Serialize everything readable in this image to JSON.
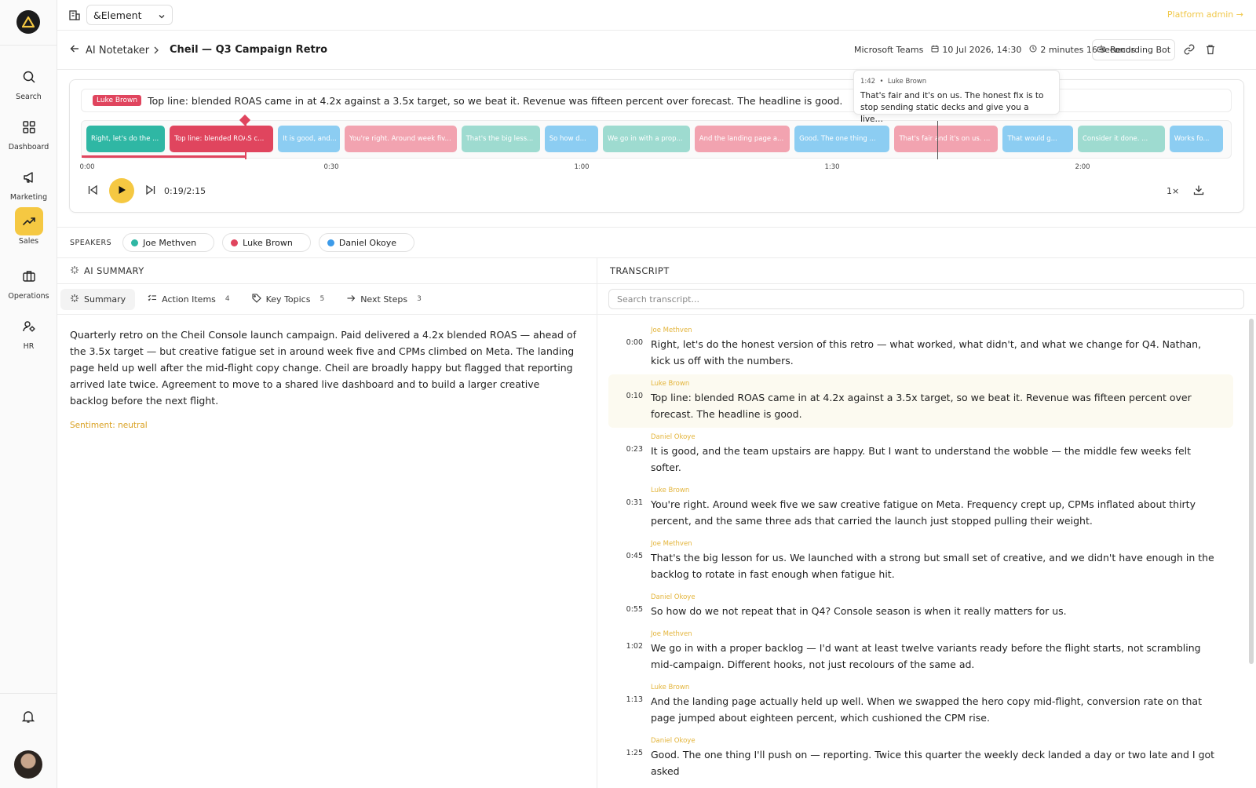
{
  "sidebar": {
    "items": [
      {
        "label": "Search",
        "icon": "search-icon"
      },
      {
        "label": "Dashboard",
        "icon": "dashboard-icon"
      },
      {
        "label": "Marketing",
        "icon": "megaphone-icon"
      },
      {
        "label": "Sales",
        "icon": "trending-up-icon",
        "active": true
      },
      {
        "label": "Operations",
        "icon": "briefcase-icon"
      },
      {
        "label": "HR",
        "icon": "people-icon"
      }
    ]
  },
  "topbar": {
    "org": "&Element",
    "platform_admin": "Platform admin →"
  },
  "header": {
    "back_label": "AI Notetaker",
    "title": "Cheil — Q3 Campaign Retro",
    "platform": "Microsoft Teams",
    "date": "10 Jul 2026, 14:30",
    "duration": "2 minutes 16 seconds",
    "recording_bot": "Recording Bot"
  },
  "player": {
    "caption_speaker": "Luke Brown",
    "caption_text": "Top line: blended ROAS came in at 4.2x against a 3.5x target, so we beat it. Revenue was fifteen percent over forecast. The headline is good.",
    "segments": [
      {
        "label": "Right, let's do the ...",
        "color": "#2fb7a4",
        "start": 0,
        "end": 10
      },
      {
        "label": "Top line: blended ROAS c...",
        "color": "#e0455e",
        "start": 10,
        "end": 23
      },
      {
        "label": "It is good, and...",
        "color": "#8ccdf2",
        "start": 23,
        "end": 31
      },
      {
        "label": "You're right. Around week fiv...",
        "color": "#f2a3b0",
        "start": 31,
        "end": 45
      },
      {
        "label": "That's the big less...",
        "color": "#9edbd0",
        "start": 45,
        "end": 55
      },
      {
        "label": "So how d...",
        "color": "#8ccdf2",
        "start": 55,
        "end": 62
      },
      {
        "label": "We go in with a prop...",
        "color": "#9edbd0",
        "start": 62,
        "end": 73
      },
      {
        "label": "And the landing page a...",
        "color": "#f2a3b0",
        "start": 73,
        "end": 85
      },
      {
        "label": "Good. The one thing ...",
        "color": "#8ccdf2",
        "start": 85,
        "end": 97
      },
      {
        "label": "That's fair and it's on us. ...",
        "color": "#f2a3b0",
        "start": 97,
        "end": 110
      },
      {
        "label": "That would g...",
        "color": "#8ccdf2",
        "start": 110,
        "end": 119
      },
      {
        "label": "Consider it done. ...",
        "color": "#9edbd0",
        "start": 119,
        "end": 130
      },
      {
        "label": "Works fo...",
        "color": "#8ccdf2",
        "start": 130,
        "end": 137
      }
    ],
    "ticks": [
      "0:00",
      "0:30",
      "1:00",
      "1:30",
      "2:00"
    ],
    "current_time": "0:19/2:15",
    "progress_seconds": 19,
    "total_seconds": 135,
    "speed": "1×",
    "tooltip": {
      "time": "1:42",
      "speaker": "Luke Brown",
      "text": "That's fair and it's on us. The honest fix is to stop sending static decks and give you a live…"
    }
  },
  "speakers": {
    "label": "SPEAKERS",
    "list": [
      {
        "name": "Joe Methven",
        "color": "#2fb7a4"
      },
      {
        "name": "Luke Brown",
        "color": "#e0455e"
      },
      {
        "name": "Daniel Okoye",
        "color": "#3d9be9"
      }
    ]
  },
  "summary_panel": {
    "title": "AI SUMMARY",
    "tabs": [
      {
        "label": "Summary",
        "count": ""
      },
      {
        "label": "Action Items",
        "count": "4"
      },
      {
        "label": "Key Topics",
        "count": "5"
      },
      {
        "label": "Next Steps",
        "count": "3"
      }
    ],
    "text": "Quarterly retro on the Cheil Console launch campaign. Paid delivered a 4.2x blended ROAS — ahead of the 3.5x target — but creative fatigue set in around week five and CPMs climbed on Meta. The landing page held up well after the mid-flight copy change. Cheil are broadly happy but flagged that reporting arrived late twice. Agreement to move to a shared live dashboard and to build a larger creative backlog before the next flight.",
    "sentiment": "Sentiment: neutral"
  },
  "transcript": {
    "title": "TRANSCRIPT",
    "search_placeholder": "Search transcript...",
    "entries": [
      {
        "time": "0:00",
        "speaker": "Joe Methven",
        "text": "Right, let's do the honest version of this retro — what worked, what didn't, and what we change for Q4. Nathan, kick us off with the numbers."
      },
      {
        "time": "0:10",
        "speaker": "Luke Brown",
        "text": "Top line: blended ROAS came in at 4.2x against a 3.5x target, so we beat it. Revenue was fifteen percent over forecast. The headline is good.",
        "highlight": true
      },
      {
        "time": "0:23",
        "speaker": "Daniel Okoye",
        "text": "It is good, and the team upstairs are happy. But I want to understand the wobble — the middle few weeks felt softer."
      },
      {
        "time": "0:31",
        "speaker": "Luke Brown",
        "text": "You're right. Around week five we saw creative fatigue on Meta. Frequency crept up, CPMs inflated about thirty percent, and the same three ads that carried the launch just stopped pulling their weight."
      },
      {
        "time": "0:45",
        "speaker": "Joe Methven",
        "text": "That's the big lesson for us. We launched with a strong but small set of creative, and we didn't have enough in the backlog to rotate in fast enough when fatigue hit."
      },
      {
        "time": "0:55",
        "speaker": "Daniel Okoye",
        "text": "So how do we not repeat that in Q4? Console season is when it really matters for us."
      },
      {
        "time": "1:02",
        "speaker": "Joe Methven",
        "text": "We go in with a proper backlog — I'd want at least twelve variants ready before the flight starts, not scrambling mid-campaign. Different hooks, not just recolours of the same ad."
      },
      {
        "time": "1:13",
        "speaker": "Luke Brown",
        "text": "And the landing page actually held up well. When we swapped the hero copy mid-flight, conversion rate on that page jumped about eighteen percent, which cushioned the CPM rise."
      },
      {
        "time": "1:25",
        "speaker": "Daniel Okoye",
        "text": "Good. The one thing I'll push on — reporting. Twice this quarter the weekly deck landed a day or two late and I got asked"
      }
    ]
  }
}
